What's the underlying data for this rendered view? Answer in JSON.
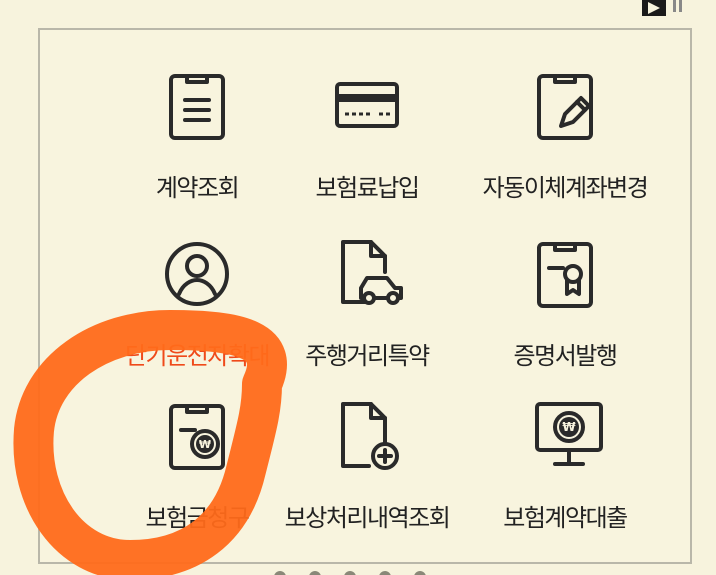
{
  "menu": {
    "items": [
      {
        "label": "계약조회",
        "icon": "document-list-icon"
      },
      {
        "label": "보험료납입",
        "icon": "credit-card-icon"
      },
      {
        "label": "자동이체계좌변경",
        "icon": "edit-document-icon"
      },
      {
        "label": "단기운전자확대",
        "icon": "user-circle-icon"
      },
      {
        "label": "주행거리특약",
        "icon": "car-document-icon"
      },
      {
        "label": "증명서발행",
        "icon": "certificate-icon"
      },
      {
        "label": "보험금청구",
        "icon": "won-document-icon"
      },
      {
        "label": "보상처리내역조회",
        "icon": "add-document-icon"
      },
      {
        "label": "보험계약대출",
        "icon": "won-monitor-icon"
      }
    ]
  },
  "colors": {
    "background": "#f7f3dd",
    "icon_stroke": "#2a2a2a",
    "highlight": "#ff6a1a"
  }
}
